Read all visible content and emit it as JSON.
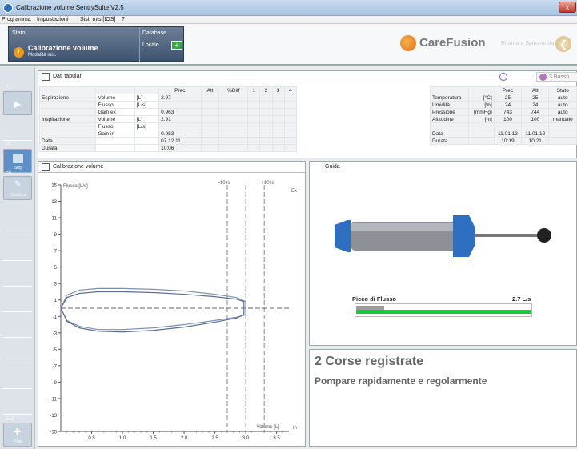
{
  "window": {
    "title": "Calibrazione volume  SentrySuite  V2.5",
    "close": "x"
  },
  "menu": [
    "Programma",
    "Impostazioni",
    "Sist. mis [IOS]",
    "?"
  ],
  "stato": {
    "label": "Stato",
    "title": "Calibrazione volume",
    "subtitle": "Modalità mis.",
    "db_label": "Database",
    "db_value": "Locale"
  },
  "brand": {
    "name": "CareFusion",
    "back_label": "Ritorna a Spirometria"
  },
  "sidebar": {
    "f1": "F1",
    "f3": "F3",
    "f3_label": "Stop",
    "f4": "F4",
    "f4_label": "Modifica",
    "f12": "F12",
    "f12_label": "Fine"
  },
  "tabular": {
    "title": "Dati tabulari",
    "headers": [
      "Prec",
      "Att",
      "%Diff",
      "1",
      "2",
      "3",
      "4"
    ],
    "rows": [
      [
        "Espirazione",
        "Volume",
        "[L]",
        "2.97"
      ],
      [
        "",
        "Flusso",
        "[L/s]",
        ""
      ],
      [
        "",
        "Gain ex",
        "",
        "0.963"
      ],
      [
        "Inspirazione",
        "Volume",
        "[L]",
        "2.91"
      ],
      [
        "",
        "Flusso",
        "[L/s]",
        ""
      ],
      [
        "",
        "Gain in",
        "",
        "0.983"
      ],
      [
        "Data",
        "",
        "",
        "07.12.11"
      ],
      [
        "Durata",
        "",
        "",
        "10:06"
      ]
    ],
    "env_headers": [
      "Prec",
      "Att",
      "Stato"
    ],
    "env_rows": [
      [
        "Temperatura",
        "[°C]",
        "25",
        "25",
        "auto"
      ],
      [
        "Umidità",
        "[%]",
        "24",
        "24",
        "auto"
      ],
      [
        "Pressione",
        "[mmHg]",
        "743",
        "744",
        "auto"
      ],
      [
        "Altitudine",
        "[m]",
        "100",
        "100",
        "manuale"
      ],
      [
        "",
        "",
        "",
        "",
        ""
      ],
      [
        "Data",
        "",
        "11.01.12",
        "11.01.12",
        ""
      ],
      [
        "Durata",
        "",
        "10:19",
        "10:21",
        ""
      ]
    ],
    "btn_label": "3.Basso"
  },
  "chart": {
    "title": "Calibrazione volume",
    "ylabel": "Flusso [L/s]",
    "xlabel": "Volume [L]",
    "ex": "Ex",
    "in": "In",
    "minus10": "-10%",
    "plus10": "+10%"
  },
  "chart_data": {
    "type": "line",
    "xlabel": "Volume [L]",
    "ylabel": "Flusso [L/s]",
    "xlim": [
      0,
      3.7
    ],
    "ylim": [
      -15,
      15
    ],
    "xticks": [
      "0.5",
      "1.0",
      "1.5",
      "2.0",
      "2.5",
      "3.0",
      "3.5"
    ],
    "yticks": [
      "15",
      "13",
      "11",
      "9",
      "7",
      "5",
      "3",
      "1",
      "-1",
      "-3",
      "-5",
      "-7",
      "-9",
      "-11",
      "-13",
      "-15"
    ],
    "ref_lines": {
      "minus10": 2.7,
      "target": 3.0,
      "plus10": 3.3
    },
    "loops": [
      {
        "x": [
          0,
          0.1,
          0.3,
          0.6,
          1.0,
          1.5,
          2.0,
          2.5,
          2.85,
          3.0,
          3.0,
          2.85,
          2.5,
          2.0,
          1.5,
          1.0,
          0.6,
          0.3,
          0.1,
          0
        ],
        "y": [
          0,
          1.6,
          2.2,
          2.4,
          2.4,
          2.3,
          2.1,
          1.7,
          1.3,
          0.8,
          -0.8,
          -1.1,
          -1.5,
          -2.0,
          -2.4,
          -2.6,
          -2.6,
          -2.2,
          -1.5,
          0
        ]
      },
      {
        "x": [
          0,
          0.1,
          0.3,
          0.6,
          1.0,
          1.5,
          2.0,
          2.5,
          2.85,
          2.97,
          2.97,
          2.85,
          2.5,
          2.0,
          1.5,
          1.0,
          0.6,
          0.3,
          0.1,
          0
        ],
        "y": [
          0,
          1.3,
          1.8,
          2.0,
          2.0,
          1.9,
          1.7,
          1.4,
          1.1,
          0.8,
          -0.8,
          -1.2,
          -1.7,
          -2.3,
          -2.7,
          -2.9,
          -2.8,
          -2.4,
          -1.6,
          0
        ]
      }
    ]
  },
  "guida": {
    "title": "Guida",
    "picco_label": "Picco di Flusso",
    "picco_value": "2.7 L/s",
    "picco_fraction": 0.16
  },
  "status": {
    "title": "2 Corse registrate",
    "subtitle": "Pompare rapidamente e regolarmente"
  }
}
